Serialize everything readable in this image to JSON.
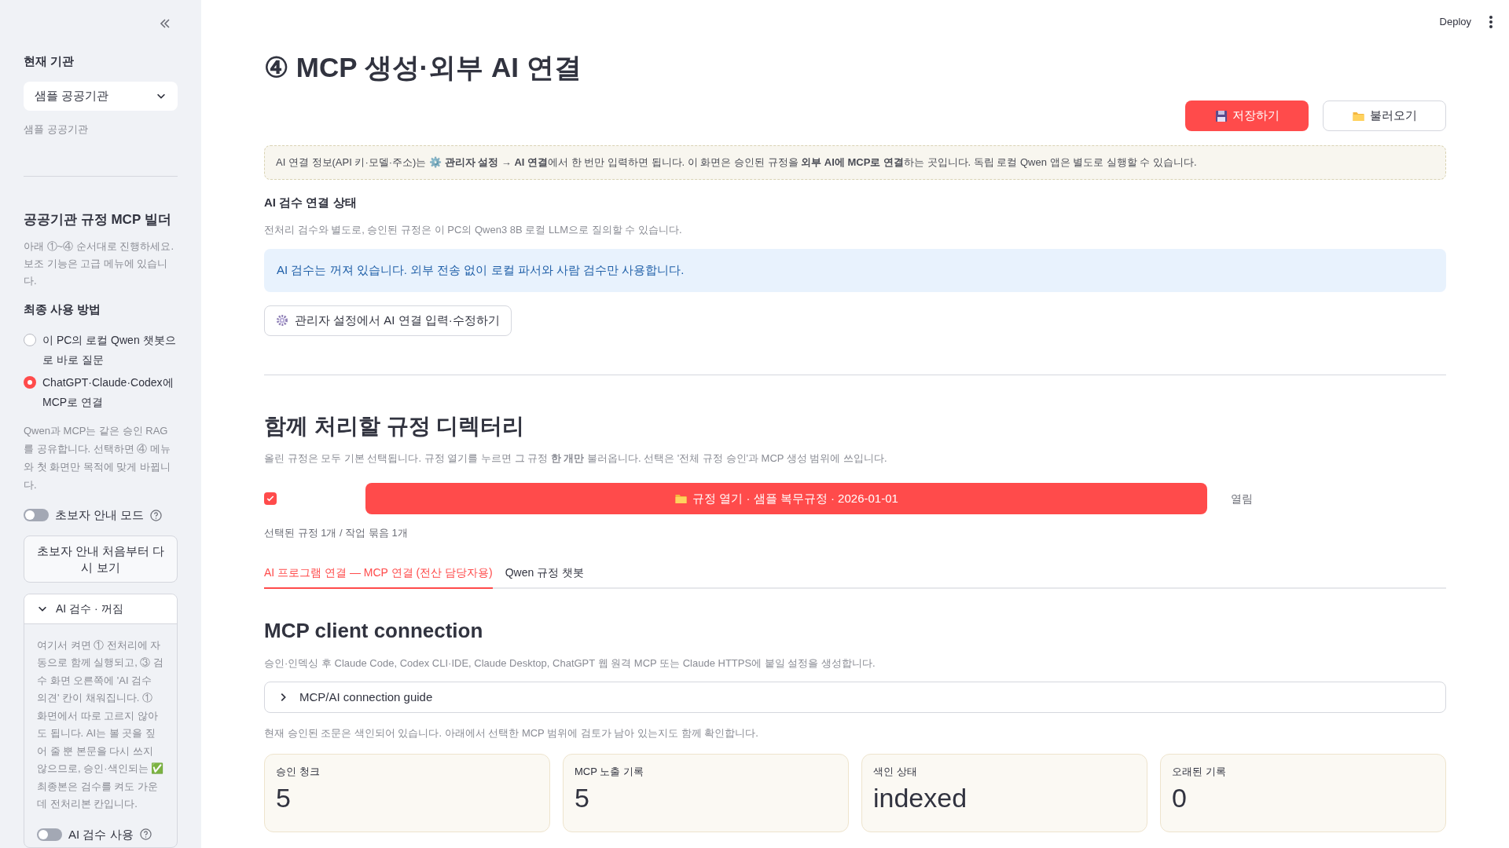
{
  "sidebar": {
    "agency_label": "현재 기관",
    "agency_select": {
      "value": "샘플 공공기관"
    },
    "agency_caption": "샘플 공공기관",
    "builder_title": "공공기관 규정 MCP 빌더",
    "builder_caption": "아래 ①~④ 순서대로 진행하세요. 보조 기능은 고급 메뉴에 있습니다.",
    "usage_title": "최종 사용 방법",
    "usage_options": [
      {
        "label": "이 PC의 로컬 Qwen 챗봇으로 바로 질문",
        "selected": false
      },
      {
        "label": "ChatGPT·Claude·Codex에 MCP로 연결",
        "selected": true
      }
    ],
    "usage_caption": "Qwen과 MCP는 같은 승인 RAG를 공유합니다. 선택하면 ④ 메뉴와 첫 화면만 목적에 맞게 바뀝니다.",
    "beginner_toggle": {
      "label": "초보자 안내 모드",
      "on": false
    },
    "restart_button": "초보자 안내 처음부터 다시 보기",
    "ai_expander": {
      "title": "AI 검수 · 꺼짐",
      "expanded": true,
      "body": "여기서 켜면 ① 전처리에 자동으로 함께 실행되고, ③ 검수 화면 오른쪽에 'AI 검수 의견' 칸이 채워집니다. ① 화면에서 따로 고르지 않아도 됩니다. AI는 볼 곳을 짚어 줄 뿐 본문을 다시 쓰지 않으므로, 승인·색인되는 ✅ 최종본은 검수를 켜도 가운데 전처리본 칸입니다.",
      "toggle": {
        "label": "AI 검수 사용",
        "on": false
      }
    }
  },
  "header": {
    "deploy": "Deploy"
  },
  "main": {
    "title": "④ MCP 생성·외부 AI 연결",
    "actions": [
      {
        "kind": "primary",
        "label": "저장하기"
      },
      {
        "kind": "secondary",
        "label": "불러오기"
      }
    ],
    "notice": "AI 연결 정보(API 키·모델·주소)는 ⚙️ **관리자 설정 → AI 연결**에서 한 번만 입력하면 됩니다. 이 화면은 승인된 규정을 **외부 AI에 MCP로 연결**하는 곳입니다. 독립 로컬 Qwen 앱은 별도로 실행할 수 있습니다.",
    "status_title": "AI 검수 연결 상태",
    "status_caption": "전처리 검수와 별도로, 승인된 규정은 이 PC의 Qwen3 8B 로컬 LLM으로 질의할 수 있습니다.",
    "status_info": "AI 검수는 꺼져 있습니다. 외부 전송 없이 로컬 파서와 사람 검수만 사용합니다.",
    "admin_button": "관리자 설정에서 AI 연결 입력·수정하기",
    "dir_title": "함께 처리할 규정 디렉터리",
    "dir_caption": "올린 규정은 모두 기본 선택됩니다. 규정 열기를 누르면 그 규정 **한 개만** 불러옵니다. 선택은 '전체 규정 승인'과 MCP 생성 범위에 쓰입니다.",
    "rules": [
      {
        "checked": true,
        "button": "규정 열기 · 샘플 복무규정 · 2026-01-01",
        "status": "열림"
      }
    ],
    "selection_summary": "선택된 규정 1개 / 작업 묶음 1개",
    "tabs": [
      {
        "label": "AI 프로그램 연결 — MCP 연결 (전산 담당자용)",
        "selected": true
      },
      {
        "label": "Qwen 규정 챗봇",
        "selected": false
      }
    ],
    "mcp_title": "MCP client connection",
    "mcp_caption": "승인·인덱싱 후 Claude Code, Codex CLI·IDE, Claude Desktop, ChatGPT 웹 원격 MCP 또는 Claude HTTPS에 붙일 설정을 생성합니다.",
    "guide_expander": {
      "title": "MCP/AI connection guide",
      "expanded": false
    },
    "index_caption": "현재 승인된 조문은 색인되어 있습니다. 아래에서 선택한 MCP 범위에 검토가 남아 있는지도 함께 확인합니다.",
    "metrics": [
      {
        "label": "승인 청크",
        "value": "5"
      },
      {
        "label": "MCP 노출 기록",
        "value": "5"
      },
      {
        "label": "색인 상태",
        "value": "indexed"
      },
      {
        "label": "오래된 기록",
        "value": "0"
      }
    ]
  }
}
